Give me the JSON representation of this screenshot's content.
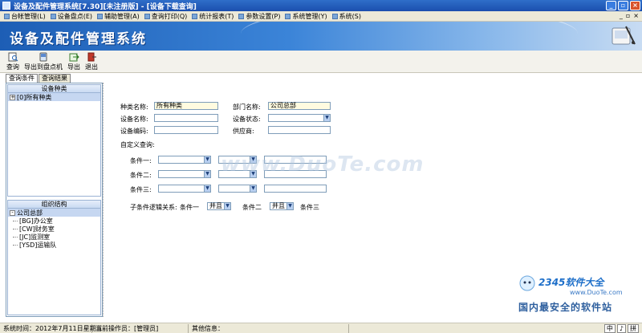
{
  "window": {
    "title": "设备及配件管理系统[7.30][未注册版] - [设备下载查询]",
    "controls": [
      "_",
      "▫",
      "×"
    ]
  },
  "menu": {
    "items": [
      "台帐管理(L)",
      "设备盘点(E)",
      "辅助管理(A)",
      "查询打印(Q)",
      "统计报表(T)",
      "参数设置(P)",
      "系统管理(Y)",
      "系统(S)"
    ],
    "right": [
      "_",
      "▫",
      "×"
    ]
  },
  "banner": {
    "title": "设备及配件管理系统"
  },
  "toolbar": {
    "buttons": [
      {
        "label": "查询",
        "icon": "search-icon"
      },
      {
        "label": "导出到盘点机",
        "icon": "export-device-icon"
      },
      {
        "label": "导出",
        "icon": "export-icon"
      },
      {
        "label": "退出",
        "icon": "exit-icon"
      }
    ]
  },
  "tabs": [
    "查询条件",
    "查询结果"
  ],
  "left": {
    "category_panel": {
      "title": "设备种类",
      "root": "[0]所有种类"
    },
    "org_panel": {
      "title": "组织结构",
      "root": "公司总部",
      "children": [
        "[BG]办公室",
        "[CW]财务室",
        "[JC]监测室",
        "[YSD]运输队"
      ]
    }
  },
  "form": {
    "category_label": "种类名称:",
    "category_value": "所有种类",
    "dept_label": "部门名称:",
    "dept_value": "公司总部",
    "device_name_label": "设备名称:",
    "device_name_value": "",
    "device_status_label": "设备状态:",
    "device_status_value": "",
    "device_code_label": "设备编码:",
    "device_code_value": "",
    "supplier_label": "供应商:",
    "supplier_value": "",
    "custom_query_label": "自定义查询:",
    "conditions": [
      {
        "label": "条件一:"
      },
      {
        "label": "条件二:"
      },
      {
        "label": "条件三:"
      }
    ],
    "logic_label": "子条件逻辑关系:",
    "logic_c1": "条件一",
    "logic_op1": "并且",
    "logic_c2": "条件二",
    "logic_op2": "并且",
    "logic_c3": "条件三"
  },
  "watermark": {
    "text": "www.DuoTe.com",
    "brand": "2345软件大全",
    "brand_url": "www.DuoTe.com",
    "brand_sub": "国内最安全的软件站"
  },
  "status": {
    "time": "系统时间：2012年7月11日星期三",
    "operator": "当前操作员：[管理员]",
    "other": "其他信息：",
    "ime": [
      "中",
      "♪",
      "拼"
    ]
  },
  "colors": {
    "title_bar": "#1b4fae",
    "banner": "#1d5eb5",
    "highlight_input": "#fffbe0"
  }
}
